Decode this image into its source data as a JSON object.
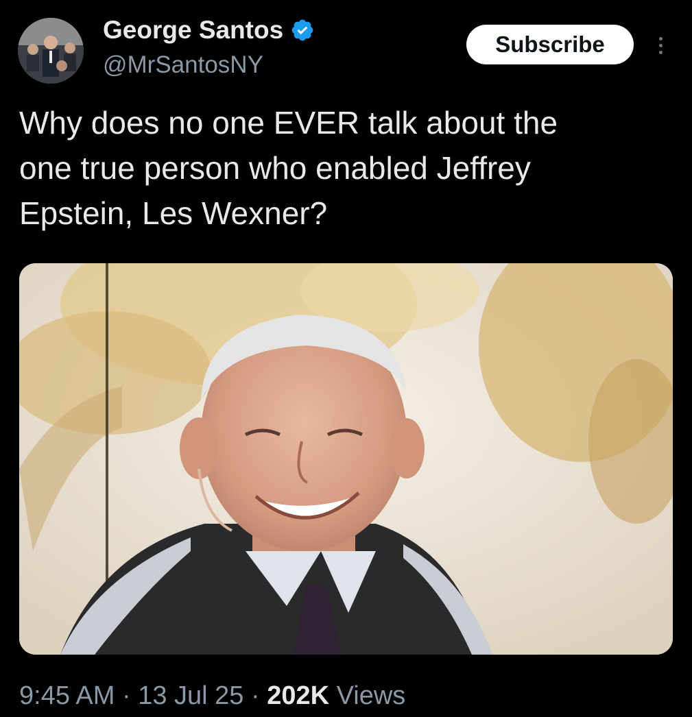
{
  "author": {
    "display_name": "George Santos",
    "handle": "@MrSantosNY",
    "verified": true,
    "verified_color": "#1d9bf0"
  },
  "actions": {
    "subscribe_label": "Subscribe",
    "more_icon": "more-vertical-icon"
  },
  "tweet": {
    "text": "Why does no one EVER talk about the\none true person who enabled Jeffrey\nEpstein, Les Wexner?"
  },
  "meta": {
    "time": "9:45 AM",
    "separator": "·",
    "date": "13 Jul 25",
    "views_count": "202K",
    "views_label": "Views"
  },
  "colors": {
    "background": "#000000",
    "text_primary": "#e7e9ea",
    "text_secondary": "#8b98a5",
    "button_bg": "#ffffff",
    "button_text": "#0f1419"
  }
}
